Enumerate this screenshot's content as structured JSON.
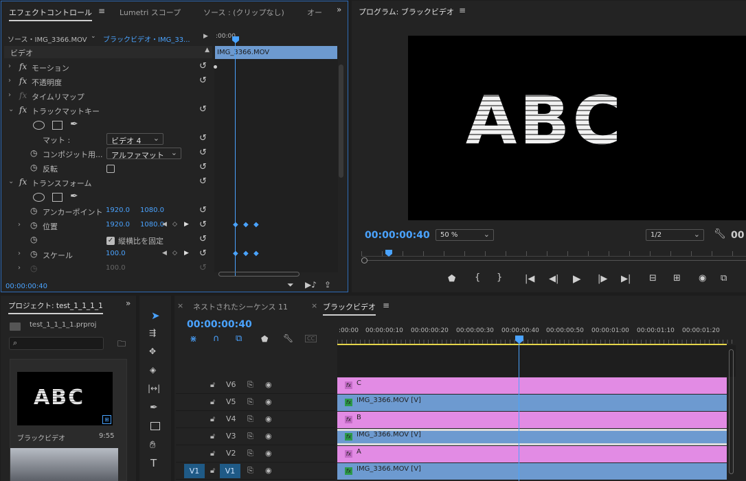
{
  "effect_panel": {
    "tabs": [
      "エフェクトコントロール",
      "Lumetri スコープ",
      "ソース : (クリップなし)",
      "オー"
    ],
    "source_label": "ソース・IMG_3366.MOV",
    "sequence_label": "ブラックビデオ・IMG_33...",
    "timeline_start": ":00:00",
    "clip_name": "IMG_3366.MOV",
    "video_header": "ビデオ",
    "rows": {
      "motion": "モーション",
      "opacity": "不透明度",
      "time_remap": "タイムリマップ",
      "track_matte": "トラックマットキー",
      "matte_label": "マット :",
      "matte_value": "ビデオ 4",
      "composite_label": "コンポジット用...",
      "composite_value": "アルファマット",
      "invert_label": "反転",
      "transform": "トランスフォーム",
      "anchor_label": "アンカーポイント",
      "anchor_x": "1920.0",
      "anchor_y": "1080.0",
      "position_label": "位置",
      "position_x": "1920.0",
      "position_y": "1080.0",
      "uniform_label": "縦横比を固定",
      "scale_label": "スケール",
      "scale_value": "100.0",
      "scale_faded": "100.0"
    },
    "timecode": "00:00:00:40"
  },
  "program": {
    "title": "プログラム: ブラックビデオ",
    "text": "ABC",
    "timecode": "00:00:00:40",
    "zoom": "50 %",
    "resolution": "1/2",
    "timecode_right": "00"
  },
  "project": {
    "title": "プロジェクト: test_1_1_1_1",
    "file": "test_1_1_1_1.prproj",
    "search_placeholder": "",
    "thumb_text": "ABC",
    "item_name": "ブラックビデオ",
    "item_duration": "9:55"
  },
  "timeline": {
    "tabs": [
      "ネストされたシーケンス 11",
      "ブラックビデオ"
    ],
    "timecode": "00:00:00:40",
    "ruler": [
      ":00:00",
      "00:00:00:10",
      "00:00:00:20",
      "00:00:00:30",
      "00:00:00:40",
      "00:00:00:50",
      "00:00:01:00",
      "00:00:01:10",
      "00:00:01:20"
    ],
    "tracks": [
      "V6",
      "V5",
      "V4",
      "V3",
      "V2",
      "V1"
    ],
    "source_patch": "V1",
    "clips": [
      {
        "label": "C",
        "kind": "fx"
      },
      {
        "label": "IMG_3366.MOV [V]",
        "kind": "video"
      },
      {
        "label": "B",
        "kind": "fx"
      },
      {
        "label": "IMG_3366.MOV [V]",
        "kind": "video"
      },
      {
        "label": "A",
        "kind": "fx"
      },
      {
        "label": "IMG_3366.MOV [V]",
        "kind": "video"
      }
    ]
  },
  "colors": {
    "accent": "#4aa3ff",
    "matte_clip": "#e28be4",
    "video_clip": "#6d9ad0",
    "panel": "#232323"
  }
}
